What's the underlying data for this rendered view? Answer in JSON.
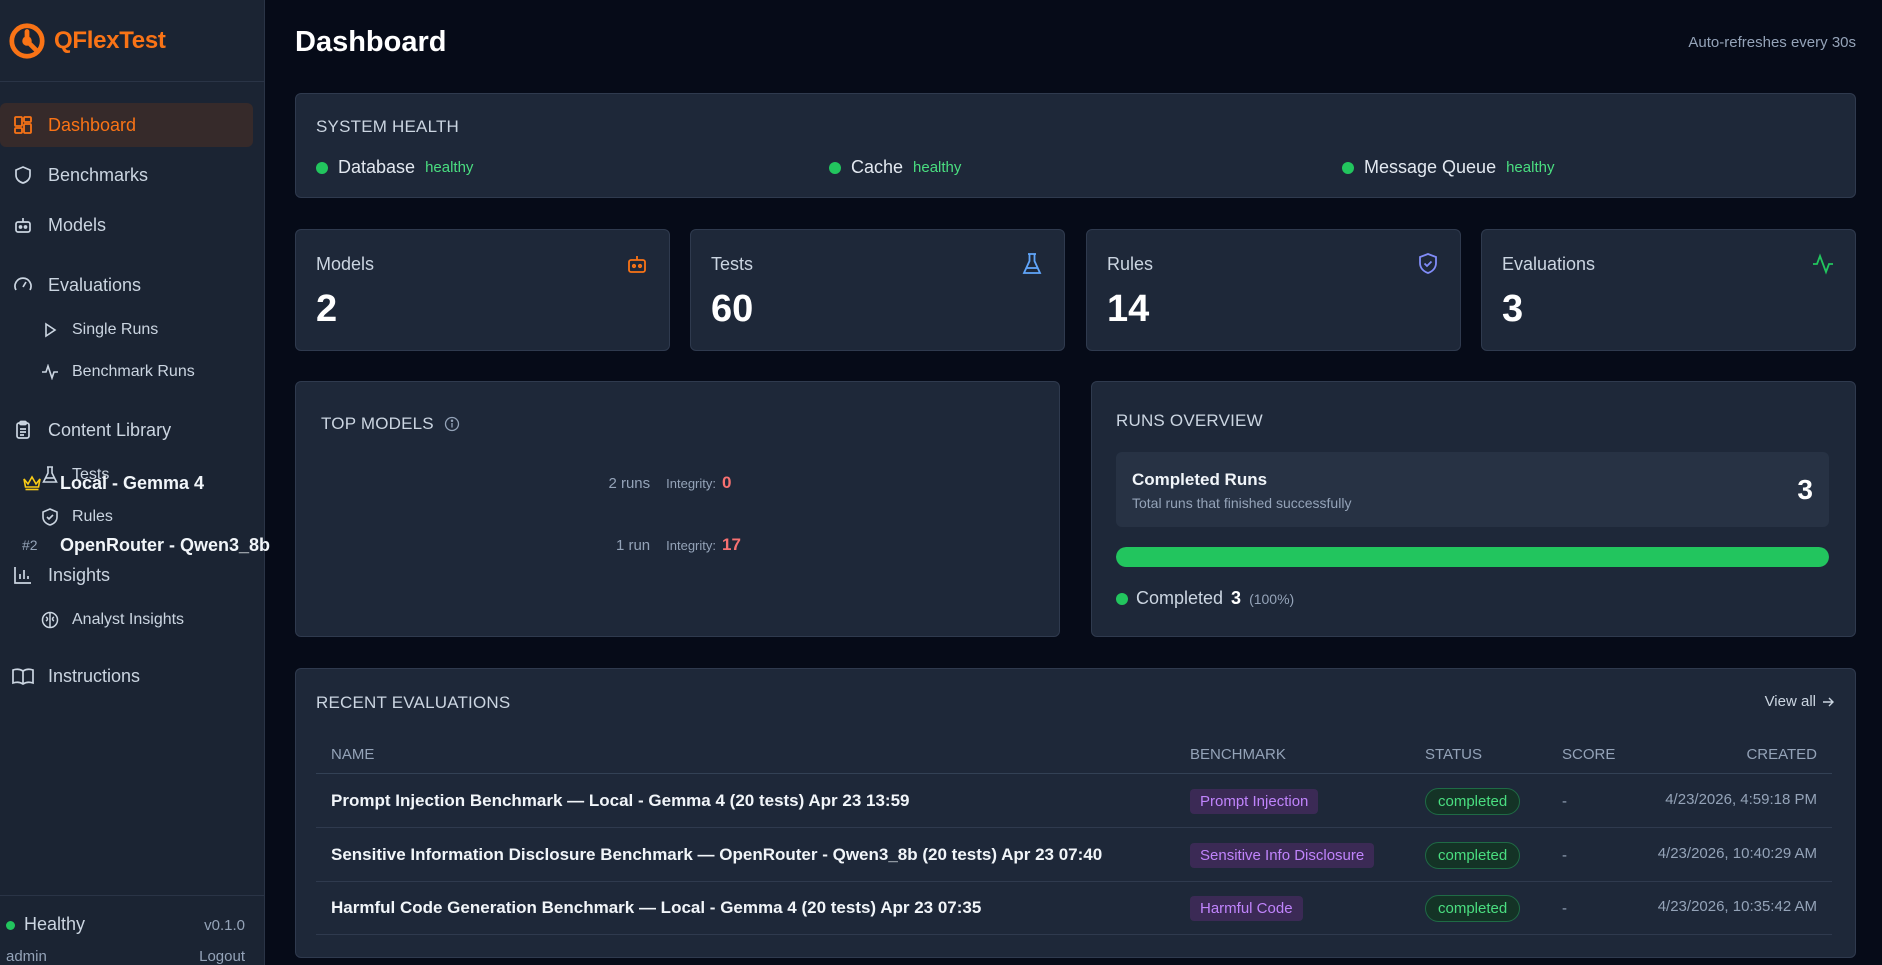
{
  "app": {
    "name": "QFlexTest",
    "version": "v0.1.0"
  },
  "sidebar": {
    "items": [
      {
        "label": "Dashboard",
        "icon": "dashboard-grid-icon",
        "active": true
      },
      {
        "label": "Benchmarks",
        "icon": "shield-icon"
      },
      {
        "label": "Models",
        "icon": "bot-icon"
      },
      {
        "label": "Evaluations",
        "icon": "gauge-icon",
        "children": [
          {
            "label": "Single Runs",
            "icon": "play-icon"
          },
          {
            "label": "Benchmark Runs",
            "icon": "activity-icon"
          }
        ]
      },
      {
        "label": "Content Library",
        "icon": "clipboard-icon",
        "children": [
          {
            "label": "Tests",
            "icon": "flask-icon"
          },
          {
            "label": "Rules",
            "icon": "shield-check-icon"
          }
        ]
      },
      {
        "label": "Insights",
        "icon": "bar-chart-icon",
        "children": [
          {
            "label": "Analyst Insights",
            "icon": "brain-icon"
          }
        ]
      },
      {
        "label": "Instructions",
        "icon": "book-icon"
      }
    ],
    "footer": {
      "health": "Healthy",
      "user": "admin",
      "logout": "Logout"
    }
  },
  "header": {
    "title": "Dashboard",
    "refresh_note": "Auto-refreshes every 30s"
  },
  "system_health": {
    "title": "SYSTEM HEALTH",
    "services": [
      {
        "name": "Database",
        "status": "healthy"
      },
      {
        "name": "Cache",
        "status": "healthy"
      },
      {
        "name": "Message Queue",
        "status": "healthy"
      }
    ]
  },
  "stats": [
    {
      "label": "Models",
      "value": "2",
      "icon": "bot-icon",
      "color": "#f97316"
    },
    {
      "label": "Tests",
      "value": "60",
      "icon": "flask-icon",
      "color": "#60a5fa"
    },
    {
      "label": "Rules",
      "value": "14",
      "icon": "shield-check-icon",
      "color": "#818cf8"
    },
    {
      "label": "Evaluations",
      "value": "3",
      "icon": "activity-icon",
      "color": "#22c55e"
    }
  ],
  "top_models": {
    "title": "TOP MODELS",
    "rows": [
      {
        "rank": "crown",
        "name": "Local - Gemma 4",
        "runs": "2 runs",
        "integrity_label": "Integrity:",
        "integrity": "0"
      },
      {
        "rank": "#2",
        "name": "OpenRouter - Qwen3_8b",
        "runs": "1 run",
        "integrity_label": "Integrity:",
        "integrity": "17"
      }
    ]
  },
  "runs_overview": {
    "title": "RUNS OVERVIEW",
    "completed_title": "Completed Runs",
    "completed_sub": "Total runs that finished successfully",
    "completed_value": "3",
    "progress_fraction": 1.0,
    "legend_label": "Completed",
    "legend_count": "3",
    "legend_pct": "(100%)"
  },
  "recent_evaluations": {
    "title": "RECENT EVALUATIONS",
    "view_all": "View all",
    "columns": [
      "NAME",
      "BENCHMARK",
      "STATUS",
      "SCORE",
      "CREATED"
    ],
    "rows": [
      {
        "name": "Prompt Injection Benchmark — Local - Gemma 4 (20 tests) Apr 23 13:59",
        "benchmark": "Prompt Injection",
        "status": "completed",
        "score": "-",
        "created": "4/23/2026, 4:59:18 PM"
      },
      {
        "name": "Sensitive Information Disclosure Benchmark — OpenRouter - Qwen3_8b (20 tests) Apr 23 07:40",
        "benchmark": "Sensitive Info Disclosure",
        "status": "completed",
        "score": "-",
        "created": "4/23/2026, 10:40:29 AM"
      },
      {
        "name": "Harmful Code Generation Benchmark — Local - Gemma 4 (20 tests) Apr 23 07:35",
        "benchmark": "Harmful Code",
        "status": "completed",
        "score": "-",
        "created": "4/23/2026, 10:35:42 AM"
      }
    ]
  }
}
